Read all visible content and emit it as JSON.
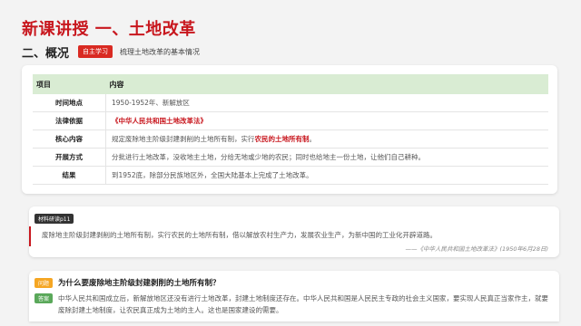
{
  "slide": {
    "title": "新课讲授 一、土地改革",
    "section": "二、概况",
    "badge": "自主学习",
    "section_desc": "梳理土地改革的基本情况"
  },
  "table": {
    "headers": [
      "项目",
      "内容"
    ],
    "rows": [
      {
        "label": "时间地点",
        "pre": "1950-1952年、新解放区",
        "highlight": "",
        "post": ""
      },
      {
        "label": "法律依据",
        "pre": "",
        "highlight": "《中华人民共和国土地改革法》",
        "post": ""
      },
      {
        "label": "核心内容",
        "pre": "规定废除地主阶级封建剥削的土地所有制，实行",
        "highlight": "农民的土地所有制",
        "post": "。"
      },
      {
        "label": "开展方式",
        "pre": "分批进行土地改革，没收地主土地，分给无地或少地的农民；同时也给地主一份土地，让他们自己耕种。",
        "highlight": "",
        "post": ""
      },
      {
        "label": "结果",
        "pre": "到1952底，除部分民族地区外，全国大陆基本上完成了土地改革。",
        "highlight": "",
        "post": ""
      }
    ]
  },
  "material": {
    "tag": "材料研读p11",
    "text": "废除地主阶级封建剥削的土地所有制，实行农民的土地所有制，借以解放农村生产力，发展农业生产，为新中国的工业化开辟道路。",
    "source": "——《中华人民共和国土地改革法》(1950年6月28日)"
  },
  "qa": {
    "q_tag": "问题",
    "question": "为什么要废除地主阶级封建剥削的土地所有制？",
    "a_tag": "答案",
    "answer": "中华人民共和国成立后，新解放地区还没有进行土地改革，封建土地制度还存在。中华人民共和国是人民民主专政的社会主义国家，要实现人民真正当家作主，就要废除封建土地制度，让农民真正成为土地的主人。这也是国家建设的需要。"
  },
  "colors": {
    "accent": "#c8171e",
    "header_bg": "#d9ecd3",
    "q_tag": "#f5a623",
    "a_tag": "#5aa85a"
  }
}
